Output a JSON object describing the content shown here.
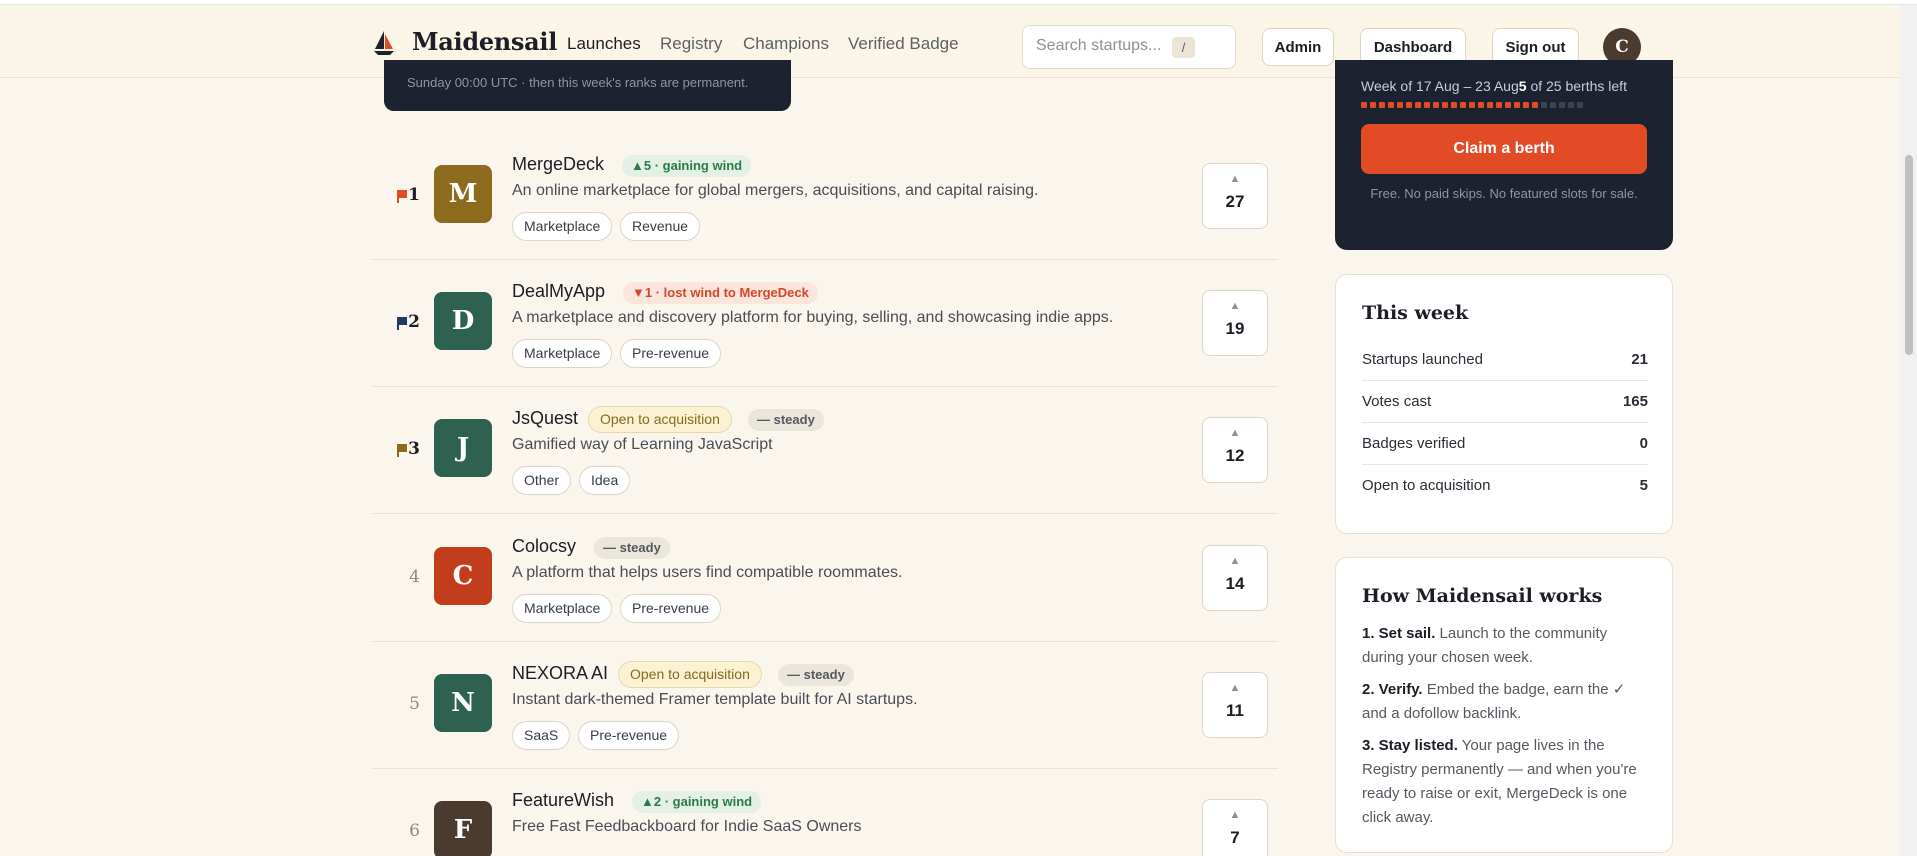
{
  "brand": {
    "name": "Maidensail"
  },
  "nav": [
    {
      "label": "Launches",
      "active": true
    },
    {
      "label": "Registry",
      "active": false
    },
    {
      "label": "Champions",
      "active": false
    },
    {
      "label": "Verified Badge",
      "active": false
    }
  ],
  "search": {
    "placeholder": "Search startups...",
    "shortcut": "/"
  },
  "header_buttons": {
    "admin": "Admin",
    "dashboard": "Dashboard",
    "signout": "Sign out"
  },
  "user": {
    "initial": "C"
  },
  "banner": {
    "text": "Sunday 00:00 UTC · then this week's ranks are permanent."
  },
  "launches": [
    {
      "rank": "1",
      "flag_color": "#e14b26",
      "initial": "M",
      "logo_color": "#8c6b1c",
      "name": "MergeDeck",
      "movement": "▲5 · gaining wind",
      "movement_type": "up",
      "acquisition": "",
      "description": "An online marketplace for global mergers, acquisitions, and capital raising.",
      "tags": [
        "Marketplace",
        "Revenue"
      ],
      "votes": "27"
    },
    {
      "rank": "2",
      "flag_color": "#243a5e",
      "initial": "D",
      "logo_color": "#2e6150",
      "name": "DealMyApp",
      "movement": "▼1 · lost wind to MergeDeck",
      "movement_type": "down",
      "acquisition": "",
      "description": "A marketplace and discovery platform for buying, selling, and showcasing indie apps.",
      "tags": [
        "Marketplace",
        "Pre-revenue"
      ],
      "votes": "19"
    },
    {
      "rank": "3",
      "flag_color": "#8c6b1c",
      "initial": "J",
      "logo_color": "#2e6150",
      "name": "JsQuest",
      "movement": "— steady",
      "movement_type": "steady",
      "acquisition": "Open to acquisition",
      "description": "Gamified way of Learning JavaScript",
      "tags": [
        "Other",
        "Idea"
      ],
      "votes": "12"
    },
    {
      "rank": "4",
      "flag_color": "",
      "initial": "C",
      "logo_color": "#c23d1c",
      "name": "Colocsy",
      "movement": "— steady",
      "movement_type": "steady",
      "acquisition": "",
      "description": "A platform that helps users find compatible roommates.",
      "tags": [
        "Marketplace",
        "Pre-revenue"
      ],
      "votes": "14"
    },
    {
      "rank": "5",
      "flag_color": "",
      "initial": "N",
      "logo_color": "#2e6150",
      "name": "NEXORA AI",
      "movement": "— steady",
      "movement_type": "steady",
      "acquisition": "Open to acquisition",
      "description": "Instant dark-themed Framer template built for AI startups.",
      "tags": [
        "SaaS",
        "Pre-revenue"
      ],
      "votes": "11"
    },
    {
      "rank": "6",
      "flag_color": "",
      "initial": "F",
      "logo_color": "#4b3a2e",
      "name": "FeatureWish",
      "movement": "▲2 · gaining wind",
      "movement_type": "up",
      "acquisition": "",
      "description": "Free Fast Feedbackboard for Indie SaaS Owners",
      "tags": [],
      "votes": "7"
    }
  ],
  "claim": {
    "week_label": "Week of 17 Aug – 23 Aug",
    "berths_left_count": "5",
    "berths_left_suffix": " of 25 berths left",
    "berths_total": 25,
    "berths_filled": 20,
    "button": "Claim a berth",
    "note": "Free. No paid skips. No featured slots for sale."
  },
  "this_week": {
    "title": "This week",
    "stats": [
      {
        "label": "Startups launched",
        "value": "21"
      },
      {
        "label": "Votes cast",
        "value": "165"
      },
      {
        "label": "Badges verified",
        "value": "0"
      },
      {
        "label": "Open to acquisition",
        "value": "5"
      }
    ]
  },
  "how_it_works": {
    "title": "How Maidensail works",
    "steps": [
      {
        "title": "1. Set sail.",
        "text": " Launch to the community during your chosen week."
      },
      {
        "title": "2. Verify.",
        "text": " Embed the badge, earn the ✓ and a dofollow backlink."
      },
      {
        "title": "3. Stay listed.",
        "text": " Your page lives in the Registry permanently — and when you're ready to raise or exit, MergeDeck is one click away."
      }
    ]
  },
  "colors": {
    "accent": "#e14b26",
    "dark": "#1c2230",
    "background": "#faf6ee"
  }
}
